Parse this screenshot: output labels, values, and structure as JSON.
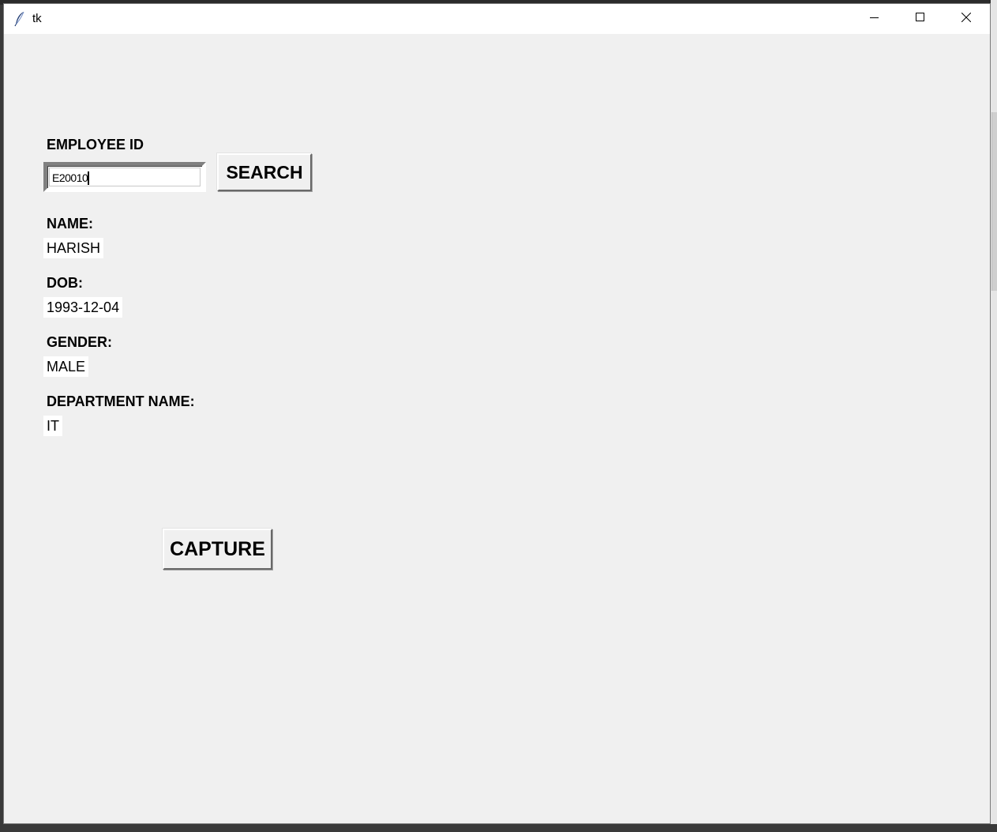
{
  "window": {
    "title": "tk"
  },
  "form": {
    "employee_id_label": "EMPLOYEE ID",
    "employee_id_value": "E20010",
    "search_label": "SEARCH",
    "name_label": "NAME:",
    "name_value": "HARISH",
    "dob_label": "DOB:",
    "dob_value": "1993-12-04",
    "gender_label": "GENDER:",
    "gender_value": "MALE",
    "department_label": "DEPARTMENT NAME:",
    "department_value": "IT",
    "capture_label": "CAPTURE"
  },
  "icons": {
    "app": "feather-icon",
    "minimize": "minimize-icon",
    "maximize": "maximize-icon",
    "close": "close-icon"
  }
}
